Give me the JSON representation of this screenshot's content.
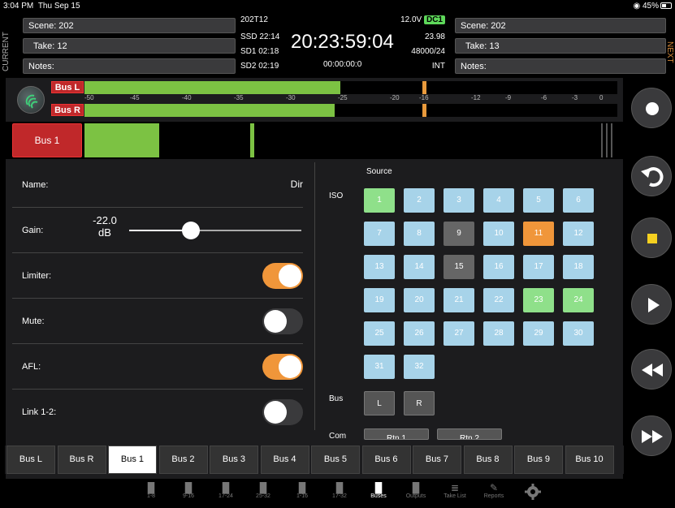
{
  "status": {
    "time": "3:04 PM",
    "date": "Thu Sep 15",
    "battery": "45%"
  },
  "header": {
    "current_label": "CURRENT",
    "next_label": "NEXT",
    "current": {
      "scene": "Scene: 202",
      "take": "Take: 12",
      "notes": "Notes:"
    },
    "next": {
      "scene": "Scene: 202",
      "take": "Take: 13",
      "notes": "Notes:"
    },
    "timecode": {
      "file": "202T12",
      "voltage": "12.0V",
      "power": "DC1",
      "ssd": "SSD 22:14",
      "sd1": "SD1 02:18",
      "sd2": "SD2 02:19",
      "tc": "20:23:59:04",
      "fps": "23.98",
      "rate": "48000/24",
      "duration": "00:00:00:0",
      "sync": "INT"
    }
  },
  "meters": {
    "bus_l": "Bus L",
    "bus_r": "Bus R",
    "level_l": 0.48,
    "level_r": 0.47,
    "scale": [
      "-50",
      "-45",
      "-40",
      "-35",
      "-30",
      "-25",
      "-20",
      "-16",
      "-12",
      "-9",
      "-6",
      "-3",
      "0"
    ]
  },
  "bus1": {
    "label": "Bus 1",
    "level": 0.14
  },
  "settings": {
    "name_label": "Name:",
    "name_value": "Dir",
    "gain_label": "Gain:",
    "gain_value": "-22.0",
    "gain_unit": "dB",
    "gain_level": 0.36,
    "limiter_label": "Limiter:",
    "limiter_on": true,
    "mute_label": "Mute:",
    "mute_on": false,
    "afl_label": "AFL:",
    "afl_on": true,
    "link_label": "Link 1-2:",
    "link_on": false
  },
  "source": {
    "title": "Source",
    "iso_label": "ISO",
    "bus_label": "Bus",
    "com_label": "Com",
    "iso": [
      "1",
      "2",
      "3",
      "4",
      "5",
      "6",
      "7",
      "8",
      "9",
      "10",
      "11",
      "12",
      "13",
      "14",
      "15",
      "16",
      "17",
      "18",
      "19",
      "20",
      "21",
      "22",
      "23",
      "24",
      "25",
      "26",
      "27",
      "28",
      "29",
      "30",
      "31",
      "32"
    ],
    "bus": [
      "L",
      "R"
    ],
    "com": [
      "Rtn 1",
      "Rtn 2"
    ]
  },
  "tabs": [
    "Bus L",
    "Bus R",
    "Bus 1",
    "Bus 2",
    "Bus 3",
    "Bus 4",
    "Bus 5",
    "Bus 6",
    "Bus 7",
    "Bus 8",
    "Bus 9",
    "Bus 10"
  ],
  "nav": [
    "1-8",
    "9-16",
    "17-24",
    "25-32",
    "1-16",
    "17-32",
    "Buses",
    "Outputs",
    "Take List",
    "Reports"
  ],
  "colors": {
    "accent_red": "#c0282a",
    "meter_green": "#7cc243",
    "toggle_orange": "#f0963a",
    "iso_blue": "#a7d3e9",
    "iso_green": "#8fe08a"
  }
}
